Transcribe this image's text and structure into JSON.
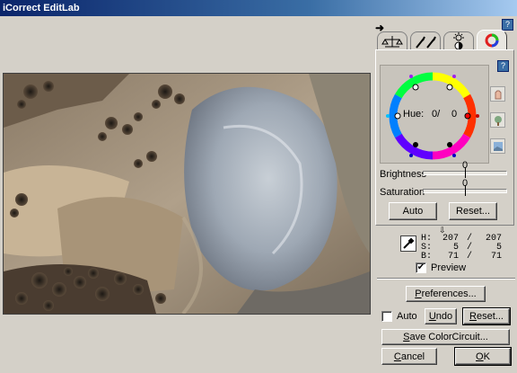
{
  "window": {
    "title": "iCorrect EditLab"
  },
  "tabs": [
    {
      "name": "balance"
    },
    {
      "name": "eyedroppers"
    },
    {
      "name": "brightness-contrast"
    },
    {
      "name": "color-wheel",
      "active": true
    }
  ],
  "wheel": {
    "hue_label": "Hue:",
    "hue_value": "0/",
    "hue_right_value": "0"
  },
  "brightness": {
    "label": "Brightness",
    "value": "0",
    "level": 0.5
  },
  "saturation": {
    "label": "Saturation",
    "value": "0",
    "level": 0.5
  },
  "panel_buttons": {
    "auto": "Auto",
    "reset": "Reset..."
  },
  "readout": {
    "h_label": "H:",
    "h_value": "207",
    "h_sep": "/",
    "h_value2": "207",
    "s_label": "S:",
    "s_value": "5",
    "s_sep": "/",
    "s_value2": "5",
    "b_label": "B:",
    "b_value": "71",
    "b_sep": "/",
    "b_value2": "71"
  },
  "preview": {
    "label": "Preview",
    "checked": true
  },
  "buttons": {
    "preferences": "Preferences...",
    "auto_check_label": "Auto",
    "undo": "Undo",
    "reset": "Reset...",
    "save": "Save ColorCircuit...",
    "cancel": "Cancel",
    "ok": "OK"
  },
  "colors": {
    "title_start": "#0a246a",
    "title_end": "#a6caf0",
    "face": "#d4d0c8"
  }
}
